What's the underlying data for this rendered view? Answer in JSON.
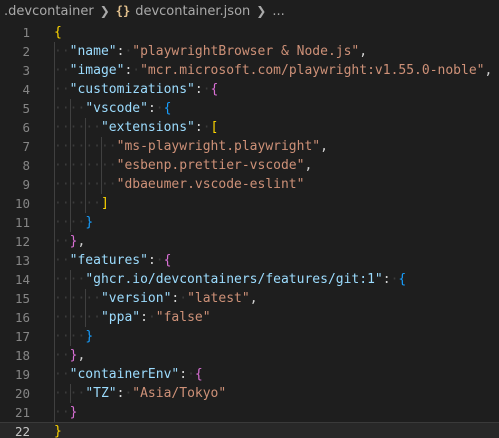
{
  "breadcrumb": {
    "folder": ".devcontainer",
    "file": "devcontainer.json",
    "trail": "...",
    "file_icon": "{}"
  },
  "editor": {
    "language": "json",
    "current_line": 22,
    "lines": [
      {
        "num": "1",
        "text": "{"
      },
      {
        "num": "2",
        "text": "  \"name\": \"playwrightBrowser & Node.js\","
      },
      {
        "num": "3",
        "text": "  \"image\": \"mcr.microsoft.com/playwright:v1.55.0-noble\","
      },
      {
        "num": "4",
        "text": "  \"customizations\": {"
      },
      {
        "num": "5",
        "text": "    \"vscode\": {"
      },
      {
        "num": "6",
        "text": "      \"extensions\": ["
      },
      {
        "num": "7",
        "text": "        \"ms-playwright.playwright\","
      },
      {
        "num": "8",
        "text": "        \"esbenp.prettier-vscode\","
      },
      {
        "num": "9",
        "text": "        \"dbaeumer.vscode-eslint\""
      },
      {
        "num": "10",
        "text": "      ]"
      },
      {
        "num": "11",
        "text": "    }"
      },
      {
        "num": "12",
        "text": "  },"
      },
      {
        "num": "13",
        "text": "  \"features\": {"
      },
      {
        "num": "14",
        "text": "    \"ghcr.io/devcontainers/features/git:1\": {"
      },
      {
        "num": "15",
        "text": "      \"version\": \"latest\","
      },
      {
        "num": "16",
        "text": "      \"ppa\": \"false\""
      },
      {
        "num": "17",
        "text": "    }"
      },
      {
        "num": "18",
        "text": "  },"
      },
      {
        "num": "19",
        "text": "  \"containerEnv\": {"
      },
      {
        "num": "20",
        "text": "    \"TZ\": \"Asia/Tokyo\""
      },
      {
        "num": "21",
        "text": "  }"
      },
      {
        "num": "22",
        "text": "}"
      }
    ]
  },
  "colors": {
    "background": "#1e1e1e",
    "key": "#9cdcfe",
    "string": "#ce9178",
    "punctuation": "#d4d4d4",
    "bracket_level1": "#ffd700",
    "bracket_level2": "#da70d6",
    "bracket_level3": "#179fff",
    "line_number": "#858585"
  }
}
